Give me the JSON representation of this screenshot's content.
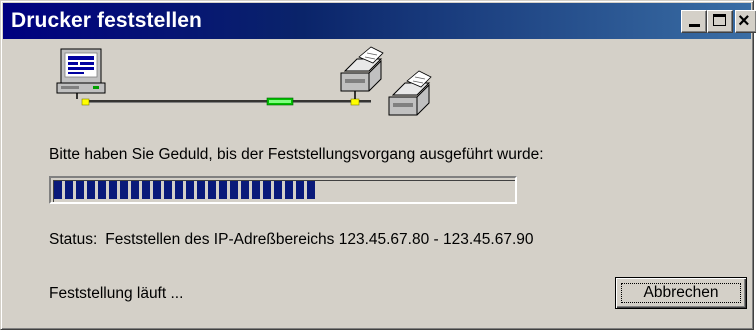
{
  "window": {
    "title": "Drucker feststellen"
  },
  "titlebar_buttons": {
    "minimize_icon": "minimize-icon",
    "maximize_icon": "maximize-icon",
    "close_icon": "close-icon",
    "close_glyph": "×"
  },
  "illustration": {
    "icons": [
      "computer-icon",
      "network-cable-icon",
      "printer-icon",
      "printer-icon"
    ]
  },
  "message": "Bitte haben Sie Geduld, bis der Feststellungsvorgang ausgeführt wurde:",
  "progress": {
    "fraction": 0.58,
    "color": "#0a1a7a"
  },
  "status": {
    "label": "Status:",
    "text": "Feststellen des IP-Adreßbereichs 123.45.67.80 - 123.45.67.90"
  },
  "footer": {
    "state_text": "Feststellung läuft ..."
  },
  "buttons": {
    "cancel_label": "Abbrechen"
  },
  "colors": {
    "titlebar": "#000080",
    "face": "#d4d0c8"
  }
}
